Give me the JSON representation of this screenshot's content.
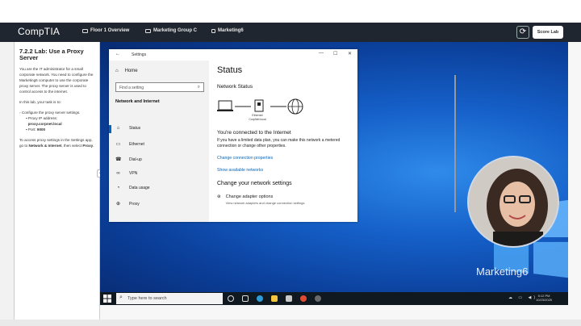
{
  "header": {
    "logo": "CompTIA",
    "breadcrumbs": [
      "Floor 1 Overview",
      "Marketing Group C",
      "Marketing6"
    ],
    "score_button": "Score Lab"
  },
  "instructions": {
    "title": "7.2.2 Lab: Use a Proxy Server",
    "intro": "You are the IT administrator for a small corporate network. You need to configure the Marketing6 computer to use the corporate proxy server. The proxy server is used to control access to the internet.",
    "task_lead": "In this lab, your task is to:",
    "task_item": "Configure the proxy server settings.",
    "proxy_ip_label": "Proxy IP address:",
    "proxy_ip_value": "proxy.corpnet.local",
    "port_label": "Port:",
    "port_value": "9000",
    "outro_pre": "To access proxy settings in the Settings app, go to",
    "outro_bold1": "Network & Internet",
    "outro_mid": ", then select",
    "outro_bold2": "Proxy"
  },
  "settings_window": {
    "title": "Settings",
    "nav": {
      "home": "Home",
      "find_placeholder": "Find a setting",
      "section": "Network and Internet",
      "items": [
        "Status",
        "Ethernet",
        "Dial-up",
        "VPN",
        "Data usage",
        "Proxy"
      ]
    },
    "content": {
      "title": "Status",
      "network_status": "Network Status",
      "ethernet_label": "Ethernet",
      "network_name": "CorpNet.local",
      "connected": "You're connected to the Internet",
      "description": "If you have a limited data plan, you can make this network a metered connection or change other properties.",
      "link_change_props": "Change connection properties",
      "link_show_networks": "Show available networks",
      "change_settings": "Change your network settings",
      "adapter_title": "Change adapter options",
      "adapter_desc": "View network adapters and change connection settings."
    }
  },
  "webcam": {
    "name": "Marketing6"
  },
  "taskbar": {
    "search_placeholder": "Type here to search",
    "time": "5:12 PM",
    "date": "10/23/2025"
  },
  "colors": {
    "header_bg": "#20262f",
    "accent_link": "#0067c0",
    "desktop_blue": "#1560c9"
  }
}
